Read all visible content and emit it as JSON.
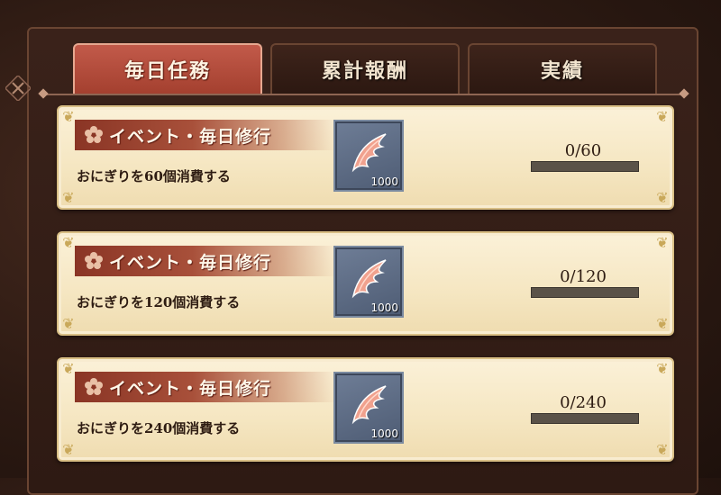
{
  "tabs": [
    {
      "label": "毎日任務",
      "active": true
    },
    {
      "label": "累計報酬",
      "active": false
    },
    {
      "label": "実績",
      "active": false
    }
  ],
  "tasks": [
    {
      "title": "イベント・毎日修行",
      "description": "おにぎりを60個消費する",
      "reward_qty": "1000",
      "reward_icon": "red-wing-icon",
      "progress": "0/60",
      "progress_fraction": 0
    },
    {
      "title": "イベント・毎日修行",
      "description": "おにぎりを120個消費する",
      "reward_qty": "1000",
      "reward_icon": "red-wing-icon",
      "progress": "0/120",
      "progress_fraction": 0
    },
    {
      "title": "イベント・毎日修行",
      "description": "おにぎりを240個消費する",
      "reward_qty": "1000",
      "reward_icon": "red-wing-icon",
      "progress": "0/240",
      "progress_fraction": 0
    }
  ],
  "colors": {
    "active_tab": "#b04a3a",
    "ribbon": "#9a4230",
    "card": "#f7e9c8"
  }
}
